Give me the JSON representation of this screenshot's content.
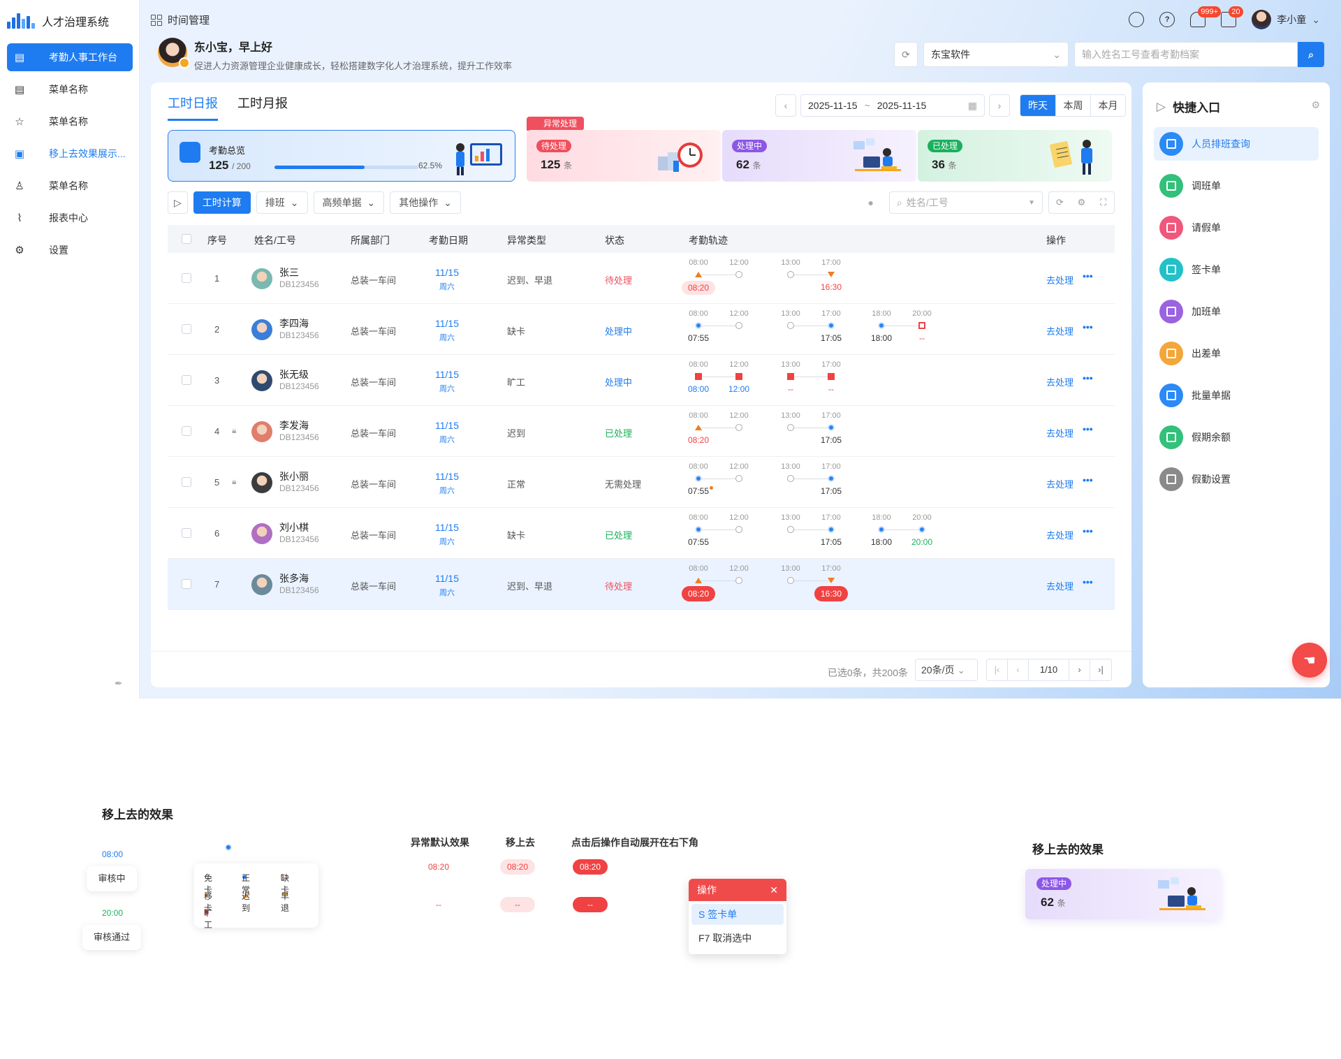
{
  "app": {
    "title": "人才治理系统",
    "breadcrumb": "时间管理"
  },
  "sidebar": {
    "items": [
      {
        "label": "考勤人事工作台",
        "icon": "chart-icon",
        "active": true
      },
      {
        "label": "菜单名称",
        "icon": "document-icon"
      },
      {
        "label": "菜单名称",
        "icon": "star-icon"
      },
      {
        "label": "移上去效果展示...",
        "icon": "badge-icon",
        "link": true
      },
      {
        "label": "菜单名称",
        "icon": "thumb-icon"
      },
      {
        "label": "报表中心",
        "icon": "report-icon"
      },
      {
        "label": "设置",
        "icon": "gear-icon"
      }
    ]
  },
  "header": {
    "notif_badge": "999+",
    "msg_badge": "20",
    "user_name": "李小童",
    "greeting": "东小宝，早上好",
    "subtitle": "促进人力资源管理企业健康成长，轻松搭建数字化人才治理系统，提升工作效率",
    "company": "东宝软件",
    "search_placeholder": "输入姓名工号查看考勤档案"
  },
  "tabs": [
    "工时日报",
    "工时月报"
  ],
  "date": {
    "start": "2025-11-15",
    "sep": "~",
    "end": "2025-11-15",
    "ranges": [
      "昨天",
      "本周",
      "本月"
    ]
  },
  "summary": {
    "label": "考勤总览",
    "value": "125",
    "total": "/ 200",
    "percent_text": "62.5%",
    "percent": 0.625
  },
  "abnormal": {
    "tag": "异常处理",
    "cards": [
      {
        "pill": "待处理",
        "count": "125",
        "unit": "条",
        "color": "#f04f5e"
      },
      {
        "pill": "处理中",
        "count": "62",
        "unit": "条",
        "color": "#8c57e6"
      },
      {
        "pill": "已处理",
        "count": "36",
        "unit": "条",
        "color": "#1ab05c"
      }
    ]
  },
  "toolbar": {
    "calc": "工时计算",
    "schedule": "排班",
    "frequent": "高频单据",
    "other": "其他操作",
    "search_placeholder": "姓名/工号"
  },
  "table": {
    "headers": [
      "序号",
      "姓名/工号",
      "所属部门",
      "考勤日期",
      "异常类型",
      "状态",
      "考勤轨迹",
      "操作"
    ],
    "rows": [
      {
        "seq": "1",
        "name": "张三",
        "id": "DB123456",
        "dept": "总装一车间",
        "date": "11/15",
        "week": "周六",
        "type": "迟到、早退",
        "status": "待处理",
        "status_color": "#f04f5e",
        "op": "去处理",
        "lock": false
      },
      {
        "seq": "2",
        "name": "李四海",
        "id": "DB123456",
        "dept": "总装一车间",
        "date": "11/15",
        "week": "周六",
        "type": "缺卡",
        "status": "处理中",
        "status_color": "#1f7cf0",
        "op": "去处理",
        "lock": false
      },
      {
        "seq": "3",
        "name": "张无级",
        "id": "DB123456",
        "dept": "总装一车间",
        "date": "11/15",
        "week": "周六",
        "type": "旷工",
        "status": "处理中",
        "status_color": "#1f7cf0",
        "op": "去处理",
        "lock": false
      },
      {
        "seq": "4",
        "name": "李发海",
        "id": "DB123456",
        "dept": "总装一车间",
        "date": "11/15",
        "week": "周六",
        "type": "迟到",
        "status": "已处理",
        "status_color": "#1ab05c",
        "op": "去处理",
        "lock": true
      },
      {
        "seq": "5",
        "name": "张小丽",
        "id": "DB123456",
        "dept": "总装一车间",
        "date": "11/15",
        "week": "周六",
        "type": "正常",
        "status": "无需处理",
        "status_color": "#555555",
        "op": "去处理",
        "lock": true
      },
      {
        "seq": "6",
        "name": "刘小棋",
        "id": "DB123456",
        "dept": "总装一车间",
        "date": "11/15",
        "week": "周六",
        "type": "缺卡",
        "status": "已处理",
        "status_color": "#1ab05c",
        "op": "去处理",
        "lock": false
      },
      {
        "seq": "7",
        "name": "张多海",
        "id": "DB123456",
        "dept": "总装一车间",
        "date": "11/15",
        "week": "周六",
        "type": "迟到、早退",
        "status": "待处理",
        "status_color": "#f04f5e",
        "op": "去处理",
        "lock": false
      }
    ],
    "tracks": [
      {
        "slots": [
          [
            "08:00",
            "late",
            "08:20",
            "pill-light"
          ],
          [
            "12:00",
            "empty",
            ""
          ],
          [
            "13:00",
            "empty",
            ""
          ],
          [
            "17:00",
            "early",
            "16:30",
            "red"
          ]
        ]
      },
      {
        "slots": [
          [
            "08:00",
            "normal",
            "07:55",
            "dark"
          ],
          [
            "12:00",
            "empty",
            ""
          ],
          [
            "13:00",
            "empty",
            ""
          ],
          [
            "17:00",
            "normal",
            "17:05",
            "dark"
          ],
          [
            "18:00",
            "normal",
            "18:00",
            "dark"
          ],
          [
            "20:00",
            "missing",
            "--",
            "red"
          ]
        ]
      },
      {
        "slots": [
          [
            "08:00",
            "absent",
            "08:00",
            "blue"
          ],
          [
            "12:00",
            "absent",
            "12:00",
            "blue"
          ],
          [
            "13:00",
            "absent",
            "--",
            "red"
          ],
          [
            "17:00",
            "absent",
            "--",
            "red"
          ]
        ]
      },
      {
        "slots": [
          [
            "08:00",
            "late",
            "08:20",
            "red"
          ],
          [
            "12:00",
            "empty",
            ""
          ],
          [
            "13:00",
            "empty",
            ""
          ],
          [
            "17:00",
            "normal",
            "17:05",
            "dark"
          ]
        ]
      },
      {
        "slots": [
          [
            "08:00",
            "normal",
            "07:55",
            "dark-dot"
          ],
          [
            "12:00",
            "empty",
            ""
          ],
          [
            "13:00",
            "empty",
            ""
          ],
          [
            "17:00",
            "normal",
            "17:05",
            "dark"
          ]
        ]
      },
      {
        "slots": [
          [
            "08:00",
            "normal",
            "07:55",
            "dark"
          ],
          [
            "12:00",
            "empty",
            ""
          ],
          [
            "13:00",
            "empty",
            ""
          ],
          [
            "17:00",
            "normal",
            "17:05",
            "dark"
          ],
          [
            "18:00",
            "normal",
            "18:00",
            "dark"
          ],
          [
            "20:00",
            "normal",
            "20:00",
            "green"
          ]
        ]
      },
      {
        "slots": [
          [
            "08:00",
            "late",
            "08:20",
            "pill"
          ],
          [
            "12:00",
            "empty",
            ""
          ],
          [
            "13:00",
            "empty",
            ""
          ],
          [
            "17:00",
            "early",
            "16:30",
            "pill"
          ]
        ]
      }
    ]
  },
  "footer": {
    "info": "已选0条，共200条",
    "page_size": "20条/页",
    "page": "1/10"
  },
  "quick": {
    "title": "快捷入口",
    "items": [
      {
        "label": "人员排班查询",
        "color": "#2b8af5"
      },
      {
        "label": "调班单",
        "color": "#33c07a"
      },
      {
        "label": "请假单",
        "color": "#f0577a"
      },
      {
        "label": "签卡单",
        "color": "#22c1c9"
      },
      {
        "label": "加班单",
        "color": "#9b63e0"
      },
      {
        "label": "出差单",
        "color": "#f3a63a"
      },
      {
        "label": "批量单据",
        "color": "#2b8af5"
      },
      {
        "label": "假期余额",
        "color": "#33c07a"
      },
      {
        "label": "假勤设置",
        "color": "#8a8a8a"
      }
    ]
  },
  "lower": {
    "title_left": "移上去的效果",
    "title_right": "移上去的效果",
    "chip1_time": "08:00",
    "chip1_label": "审核中",
    "chip2_time": "20:00",
    "chip2_label": "审核通过",
    "legend": [
      "免卡",
      "正常",
      "缺卡",
      "移卡",
      "迟到",
      "早退",
      "旷工"
    ],
    "col1": "异常默认效果",
    "col2": "移上去",
    "col3": "点击后操作自动展开在右下角",
    "demo_time": "08:20",
    "demo_dash": "--",
    "popup_title": "操作",
    "popup_items": [
      "S 签卡单",
      "F7 取消选中"
    ],
    "card_pill": "处理中",
    "card_count": "62",
    "card_unit": "条"
  }
}
